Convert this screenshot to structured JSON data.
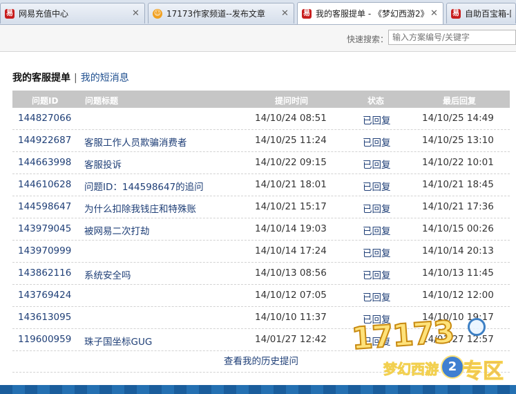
{
  "tabs": [
    {
      "icon": "netease-icon",
      "label": "网易充值中心",
      "active": false
    },
    {
      "icon": "17173-face-icon",
      "label": "17173作家频道--发布文章",
      "active": false
    },
    {
      "icon": "netease-icon",
      "label": "我的客服提单 - 《梦幻西游2》",
      "active": true
    },
    {
      "icon": "netease-icon",
      "label": "自助百宝箱-网",
      "active": false
    }
  ],
  "search": {
    "label": "快速搜索：",
    "placeholder": "输入方案编号/关键字"
  },
  "heading": {
    "current": "我的客服提单",
    "separator": "|",
    "link": "我的短消息"
  },
  "table": {
    "headers": {
      "id": "问题ID",
      "title": "问题标题",
      "time": "提问时间",
      "status": "状态",
      "last": "最后回复"
    },
    "rows": [
      {
        "id": "144827066",
        "title": "",
        "time": "14/10/24 08:51",
        "status": "已回复",
        "last": "14/10/25 14:49"
      },
      {
        "id": "144922687",
        "title": "客服工作人员欺骗消费者",
        "time": "14/10/25 11:24",
        "status": "已回复",
        "last": "14/10/25 13:10"
      },
      {
        "id": "144663998",
        "title": "客服投诉",
        "time": "14/10/22 09:15",
        "status": "已回复",
        "last": "14/10/22 10:01"
      },
      {
        "id": "144610628",
        "title": "问题ID：144598647的追问",
        "time": "14/10/21 18:01",
        "status": "已回复",
        "last": "14/10/21 18:45"
      },
      {
        "id": "144598647",
        "title": "为什么扣除我钱庄和特殊账",
        "time": "14/10/21 15:17",
        "status": "已回复",
        "last": "14/10/21 17:36"
      },
      {
        "id": "143979045",
        "title": "被网易二次打劫",
        "time": "14/10/14 19:03",
        "status": "已回复",
        "last": "14/10/15 00:26"
      },
      {
        "id": "143970999",
        "title": "",
        "time": "14/10/14 17:24",
        "status": "已回复",
        "last": "14/10/14 20:13"
      },
      {
        "id": "143862116",
        "title": "系统安全吗",
        "time": "14/10/13 08:56",
        "status": "已回复",
        "last": "14/10/13 11:45"
      },
      {
        "id": "143769424",
        "title": "",
        "time": "14/10/12 07:05",
        "status": "已回复",
        "last": "14/10/12 12:00"
      },
      {
        "id": "143613095",
        "title": "",
        "time": "14/10/10 11:37",
        "status": "已回复",
        "last": "14/10/10 19:17"
      },
      {
        "id": "119600959",
        "title": "珠子国坐标GUG",
        "time": "14/01/27 12:42",
        "status": "已回复",
        "last": "14/01/27 12:57"
      }
    ],
    "more_link": "查看我的历史提问"
  },
  "watermark": {
    "big": "17173",
    "game": "梦幻西游",
    "num": "2",
    "zone": "专区"
  },
  "colors": {
    "header_bg": "#c6c6c6",
    "link": "#1f3f77",
    "footer": "#1a5d9c"
  }
}
